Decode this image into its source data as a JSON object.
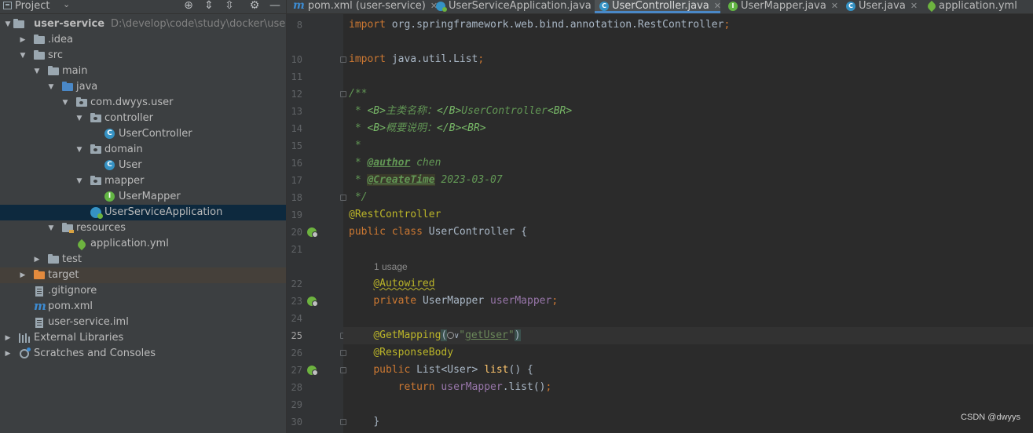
{
  "project_panel": {
    "title": "Project",
    "toolbar_icons": [
      "locate-icon",
      "expand-all-icon",
      "collapse-all-icon",
      "gear-icon",
      "minimize-icon"
    ],
    "tree": [
      {
        "label": "user-service",
        "hint": "D:\\develop\\code\\study\\docker\\user-servi",
        "icon": "module-folder-icon",
        "expanded": true,
        "bold": true
      },
      {
        "label": ".idea",
        "icon": "folder-icon",
        "expanded": false
      },
      {
        "label": "src",
        "icon": "folder-icon",
        "expanded": true
      },
      {
        "label": "main",
        "icon": "folder-icon",
        "expanded": true
      },
      {
        "label": "java",
        "icon": "source-folder-icon",
        "expanded": true
      },
      {
        "label": "com.dwyys.user",
        "icon": "package-icon",
        "expanded": true
      },
      {
        "label": "controller",
        "icon": "package-icon",
        "expanded": true
      },
      {
        "label": "UserController",
        "icon": "class-icon"
      },
      {
        "label": "domain",
        "icon": "package-icon",
        "expanded": true
      },
      {
        "label": "User",
        "icon": "class-icon"
      },
      {
        "label": "mapper",
        "icon": "package-icon",
        "expanded": true
      },
      {
        "label": "UserMapper",
        "icon": "interface-icon"
      },
      {
        "label": "UserServiceApplication",
        "icon": "spring-boot-class-icon",
        "selected": true
      },
      {
        "label": "resources",
        "icon": "resources-folder-icon",
        "expanded": true
      },
      {
        "label": "application.yml",
        "icon": "spring-config-icon"
      },
      {
        "label": "test",
        "icon": "folder-icon",
        "expanded": false
      },
      {
        "label": "target",
        "icon": "excluded-folder-icon",
        "expanded": false,
        "highlighted": true
      },
      {
        "label": ".gitignore",
        "icon": "ignore-file-icon"
      },
      {
        "label": "pom.xml",
        "icon": "maven-icon"
      },
      {
        "label": "user-service.iml",
        "icon": "iml-file-icon"
      },
      {
        "label": "External Libraries",
        "icon": "libraries-icon",
        "expanded": false
      },
      {
        "label": "Scratches and Consoles",
        "icon": "scratches-icon",
        "expanded": false
      }
    ]
  },
  "tabs": [
    {
      "label": "pom.xml (user-service)",
      "icon": "maven-icon"
    },
    {
      "label": "UserServiceApplication.java",
      "icon": "spring-boot-class-icon"
    },
    {
      "label": "UserController.java",
      "icon": "class-icon",
      "active": true
    },
    {
      "label": "UserMapper.java",
      "icon": "interface-icon"
    },
    {
      "label": "User.java",
      "icon": "class-icon"
    },
    {
      "label": "application.yml",
      "icon": "spring-config-icon"
    }
  ],
  "editor": {
    "line_numbers": [
      "8",
      "10",
      "11",
      "12",
      "13",
      "14",
      "15",
      "16",
      "17",
      "18",
      "19",
      "20",
      "21",
      "22",
      "23",
      "24",
      "25",
      "26",
      "27",
      "28",
      "29",
      "30"
    ],
    "current_line": "25",
    "code": {
      "l8_kw": "import ",
      "l8_pkg": "org.springframework.web.bind.annotation.RestController",
      "l8_semi": ";",
      "l10_kw": "import ",
      "l10_pkg": "java.util.List",
      "l10_semi": ";",
      "l12": "/**",
      "l13_star": " * ",
      "l13_b1": "<B>",
      "l13_txt": "主类名称：",
      "l13_b2": "</B>",
      "l13_name": "UserController",
      "l13_br": "<BR>",
      "l14_star": " * ",
      "l14_b1": "<B>",
      "l14_txt": "概要说明：",
      "l14_b2": "</B>",
      "l14_br": "<BR>",
      "l15": " *",
      "l16_star": " * ",
      "l16_tag": "@author",
      "l16_val": " chen",
      "l17_star": " * ",
      "l17_tag": "@CreateTime",
      "l17_val": " 2023-03-07",
      "l18": " */",
      "l19": "@RestController",
      "l20_kw": "public class ",
      "l20_name": "UserController {",
      "usage": "1 usage",
      "l22": "@Autowired",
      "l23_kw": "private ",
      "l23_type": "UserMapper ",
      "l23_field": "userMapper",
      "l23_semi": ";",
      "l25_ann": "@GetMapping",
      "l25_open": "(",
      "l25_chev": "∨",
      "l25_q1": "\"",
      "l25_str": "getUser",
      "l25_q2": "\"",
      "l25_close": ")",
      "l26": "@ResponseBody",
      "l27_kw": "public ",
      "l27_type": "List<User> ",
      "l27_method": "list",
      "l27_rest": "() {",
      "l28_kw": "return ",
      "l28_field": "userMapper",
      "l28_call": ".list()",
      "l28_semi": ";",
      "l30": "}"
    }
  },
  "watermark": "CSDN @dwyys",
  "colors": {
    "background": "#2b2b2b",
    "panel": "#3c3f41",
    "selection": "#0d293e",
    "keyword": "#cc7832",
    "annotation": "#bbb529",
    "doc_comment": "#629755",
    "field": "#9876aa",
    "method": "#ffc66d",
    "string": "#6a8759",
    "accent": "#4a88c7"
  }
}
